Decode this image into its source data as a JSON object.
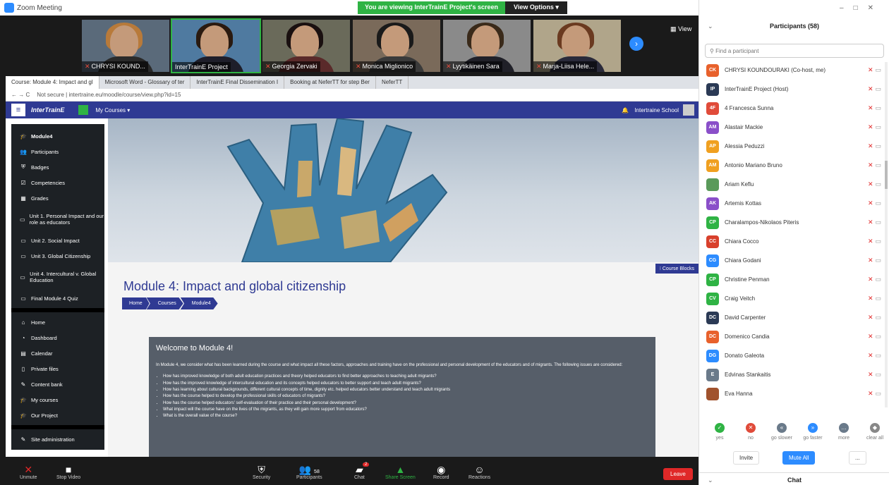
{
  "window": {
    "title": "Zoom Meeting"
  },
  "share_banner": {
    "text": "You are viewing InterTrainE Project's screen",
    "view_options": "View Options"
  },
  "video_strip": {
    "tiles": [
      {
        "name": "CHRYSI KOUND..."
      },
      {
        "name": "InterTrainE Project"
      },
      {
        "name": "Georgia Zervaki"
      },
      {
        "name": "Monica Miglionico"
      },
      {
        "name": "Lyytikäinen Sara"
      },
      {
        "name": "Marja-Liisa Hele..."
      }
    ],
    "view_label": "View"
  },
  "browser": {
    "tabs": [
      "Course: Module 4: Impact and gl",
      "Microsoft Word - Glossary of ter",
      "InterTrainE Final Dissemination I",
      "Booking at NeferTT for step Ber",
      "NeferTT"
    ],
    "address": "Not secure | intertraine.eu/moodle/course/view.php?id=15"
  },
  "moodle": {
    "logo": "InterTrainE",
    "my_courses": "My Courses",
    "school": "Intertraine School",
    "sidebar": [
      {
        "label": "Module4",
        "icon": "graduation-cap-icon",
        "glyph": "🎓"
      },
      {
        "label": "Participants",
        "icon": "users-icon",
        "glyph": "👥"
      },
      {
        "label": "Badges",
        "icon": "shield-icon",
        "glyph": "⛨"
      },
      {
        "label": "Competencies",
        "icon": "check-square-icon",
        "glyph": "☑"
      },
      {
        "label": "Grades",
        "icon": "table-icon",
        "glyph": "▦"
      },
      {
        "label": "Unit 1. Personal Impact and our role as educators",
        "icon": "folder-icon",
        "glyph": "▭"
      },
      {
        "label": "Unit 2. Social Impact",
        "icon": "folder-icon",
        "glyph": "▭"
      },
      {
        "label": "Unit 3. Global Citizenship",
        "icon": "folder-icon",
        "glyph": "▭"
      },
      {
        "label": "Unit 4. Intercultural v. Global Education",
        "icon": "folder-icon",
        "glyph": "▭"
      },
      {
        "label": "Final Module 4 Quiz",
        "icon": "folder-icon",
        "glyph": "▭"
      }
    ],
    "sidebar2": [
      {
        "label": "Home",
        "icon": "home-icon",
        "glyph": "⌂"
      },
      {
        "label": "Dashboard",
        "icon": "dashboard-icon",
        "glyph": "◔"
      },
      {
        "label": "Calendar",
        "icon": "calendar-icon",
        "glyph": "▤"
      },
      {
        "label": "Private files",
        "icon": "file-icon",
        "glyph": "▯"
      },
      {
        "label": "Content bank",
        "icon": "pencil-icon",
        "glyph": "✎"
      },
      {
        "label": "My courses",
        "icon": "graduation-cap-icon",
        "glyph": "🎓"
      },
      {
        "label": "Our Project",
        "icon": "graduation-cap-icon",
        "glyph": "🎓"
      }
    ],
    "site_admin": "Site administration",
    "course_blocks": "Course Blocks",
    "page_title": "Module 4: Impact and global citizenship",
    "breadcrumb": [
      "Home",
      "Courses",
      "Module4"
    ],
    "welcome": {
      "heading": "Welcome to Module 4!",
      "intro": "In Module 4, we consider what has been learned during the course and what impact all these factors, approaches and training have on the professional and personal development of the educators and of migrants. The following issues are considered:",
      "bullets": [
        "How has improved knowledge of both adult education practices and theory helped educators to find better approaches to teaching adult migrants?",
        "How has the improved knowledge of intercultural education and its concepts helped educators to better support and teach adult migrants?",
        "How has learning about cultural backgrounds, different cultural concepts of time, dignity etc. helped educators better understand and teach adult migrants",
        "How has the course helped to develop the professional skills of educators of migrants?",
        "How has the course helped educators' self-evaluation of their practice and their personal development?",
        "What impact will the course have on the lives of the migrants, as they will gain more support from educators?",
        "What is the overall value of the course?"
      ]
    }
  },
  "toolbar": {
    "unmute": "Unmute",
    "stop_video": "Stop Video",
    "security": "Security",
    "participants": "Participants",
    "participants_count": "58",
    "chat": "Chat",
    "chat_badge": "2",
    "share_screen": "Share Screen",
    "record": "Record",
    "reactions": "Reactions",
    "leave": "Leave"
  },
  "panel": {
    "title": "Participants (58)",
    "search_placeholder": "Find a participant",
    "participants": [
      {
        "initials": "CK",
        "name": "CHRYSI KOUNDOURAKI (Co-host, me)",
        "color": "#e8612c"
      },
      {
        "initials": "IP",
        "name": "InterTrainE Project (Host)",
        "color": "#2b3a55"
      },
      {
        "initials": "4F",
        "name": "4 Francesca Sunna",
        "color": "#e04b3a"
      },
      {
        "initials": "AM",
        "name": "Alastair Mackie",
        "color": "#8a4fc9"
      },
      {
        "initials": "AP",
        "name": "Alessia Peduzzi",
        "color": "#f0a020"
      },
      {
        "initials": "AM",
        "name": "Antonio Mariano Bruno",
        "color": "#f0a020"
      },
      {
        "initials": "",
        "name": "Ariam Keflu",
        "color": "#5a9a5a"
      },
      {
        "initials": "AK",
        "name": "Artemis Kottas",
        "color": "#8a4fc9"
      },
      {
        "initials": "CP",
        "name": "Charalampos-Nikolaos Piteris",
        "color": "#2fb344"
      },
      {
        "initials": "CC",
        "name": "Chiara Cocco",
        "color": "#d8402c"
      },
      {
        "initials": "CG",
        "name": "Chiara Godani",
        "color": "#2d8cff"
      },
      {
        "initials": "CP",
        "name": "Christine Penman",
        "color": "#2fb344"
      },
      {
        "initials": "CV",
        "name": "Craig Veitch",
        "color": "#2fb344"
      },
      {
        "initials": "DC",
        "name": "David Carpenter",
        "color": "#2b3a55"
      },
      {
        "initials": "DC",
        "name": "Domenico Candia",
        "color": "#e8612c"
      },
      {
        "initials": "DG",
        "name": "Donato Galeota",
        "color": "#2d8cff"
      },
      {
        "initials": "E",
        "name": "Edvinas Stankaitis",
        "color": "#6a7a8a"
      },
      {
        "initials": "",
        "name": "Eva Hanna",
        "color": "#a0522d"
      }
    ],
    "reactions": [
      {
        "label": "yes",
        "color": "#2fb344",
        "glyph": "✓"
      },
      {
        "label": "no",
        "color": "#e04b3a",
        "glyph": "✕"
      },
      {
        "label": "go slower",
        "color": "#6a7a8a",
        "glyph": "«"
      },
      {
        "label": "go faster",
        "color": "#2d8cff",
        "glyph": "»"
      },
      {
        "label": "more",
        "color": "#6a7a8a",
        "glyph": "…"
      },
      {
        "label": "clear all",
        "color": "#888888",
        "glyph": "◆"
      }
    ],
    "invite": "Invite",
    "mute_all": "Mute All",
    "more": "...",
    "chat_title": "Chat"
  }
}
